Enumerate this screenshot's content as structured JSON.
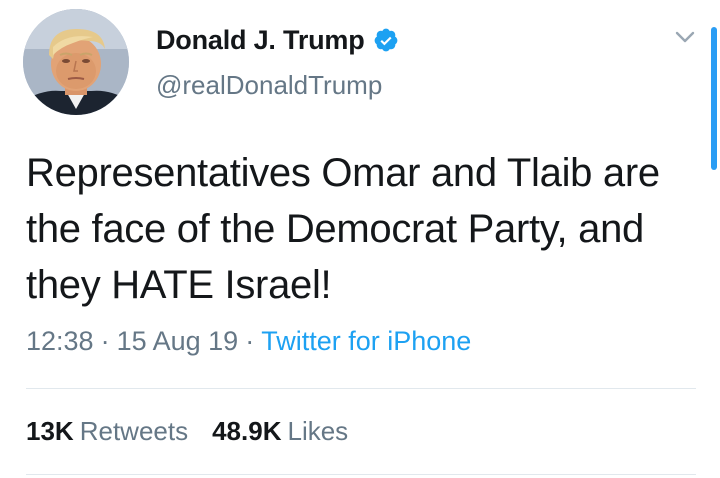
{
  "tweet": {
    "author": {
      "display_name": "Donald J. Trump",
      "handle": "@realDonaldTrump",
      "verified": true
    },
    "text": "Representatives Omar and Tlaib are the face of the Democrat Party, and they HATE Israel!",
    "time": "12:38",
    "date": "15 Aug 19",
    "separator": "·",
    "source": "Twitter for iPhone",
    "stats": {
      "retweets_count": "13K",
      "retweets_label": "Retweets",
      "likes_count": "48.9K",
      "likes_label": "Likes"
    }
  },
  "icons": {
    "verified": "verified-badge-icon",
    "menu": "chevron-down-icon"
  },
  "colors": {
    "text_primary": "#14171a",
    "text_secondary": "#657786",
    "link": "#1da1f2",
    "divider": "#e1e8ed",
    "verified_badge": "#1da1f2",
    "scrollbar": "#2a9df4"
  }
}
